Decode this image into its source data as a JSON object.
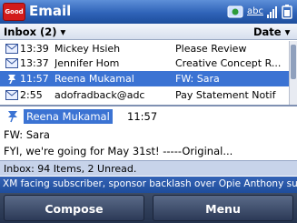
{
  "titlebar": {
    "logo_text": "Good",
    "title": "Email",
    "abc_label": "abc",
    "icons": [
      "connectivity-icon",
      "signal-strength-icon",
      "battery-icon"
    ]
  },
  "header": {
    "folder": "Inbox (2) ▾",
    "sort": "Date ▾"
  },
  "messages": [
    {
      "icon": "envelope-icon",
      "time": "13:39",
      "sender": "Mickey Hsieh",
      "subject": "Please Review"
    },
    {
      "icon": "envelope-icon",
      "time": "13:37",
      "sender": "Jennifer Hom",
      "subject": "Creative Concept R..."
    },
    {
      "icon": "pushpin-icon",
      "time": "11:57",
      "sender": "Reena Mukamal",
      "subject": "FW: Sara"
    },
    {
      "icon": "envelope-icon",
      "time": "2:55",
      "sender": "adofradback@adc",
      "subject": "Pay Statement Notif"
    }
  ],
  "preview": {
    "sender": "Reena Mukamal",
    "time": "11:57",
    "subject": "FW: Sara",
    "body": "FYI, we're going for May 31st! -----Original..."
  },
  "status": {
    "text": "Inbox: 94 Items, 2 Unread."
  },
  "ticker": {
    "text": "XM facing subscriber, sponsor backlash over Opie  Anthony sus..."
  },
  "softkeys": {
    "left": "Compose",
    "right": "Menu"
  },
  "colors": {
    "titlebar": "#2f63b8",
    "selection": "#3b73d3",
    "status_bg": "#c7d3ea",
    "softkey_bg": "#24324d"
  }
}
